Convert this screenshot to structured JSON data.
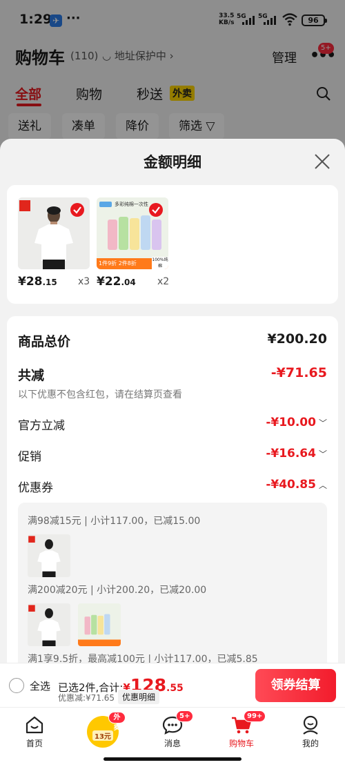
{
  "status_bar": {
    "time": "1:29",
    "dots": "···",
    "net_speed": "33.5",
    "net_unit": "KB/s",
    "sig1": "5G",
    "sig2": "5G",
    "battery": "96"
  },
  "header": {
    "title": "购物车",
    "count": "(110)",
    "address_protect": "地址保护中 ›",
    "manage": "管理",
    "more_badge": "5+"
  },
  "tabs": [
    {
      "label": "全部",
      "active": true
    },
    {
      "label": "购物"
    },
    {
      "label": "秒送"
    }
  ],
  "takeout_tag": "外卖",
  "chips": [
    "送礼",
    "凑单",
    "降价",
    "筛选"
  ],
  "sheet": {
    "title": "金额明细",
    "goods": [
      {
        "price_main": "¥28",
        "price_dec": ".15",
        "qty": "x3",
        "thumb_text": "UNIQLO"
      },
      {
        "price_main": "¥22",
        "price_dec": ".04",
        "qty": "x2",
        "banner_left": "1件9折 2件8折",
        "banner_right": "100%纯棉",
        "pack_title": "多彩纯棉一次性"
      }
    ],
    "rows": {
      "total_label": "商品总价",
      "total_value": "¥200.20",
      "reduce_label": "共减",
      "reduce_value": "-¥71.65",
      "reduce_note": "以下优惠不包含红包，请在结算页查看",
      "official_label": "官方立减",
      "official_value": "-¥10.00",
      "promo_label": "促销",
      "promo_value": "-¥16.64",
      "coupon_label": "优惠券",
      "coupon_value": "-¥40.85"
    },
    "coupon_details": [
      "满98减15元 | 小计117.00，已减15.00",
      "满200减20元 | 小计200.20，已减20.00",
      "满1享9.5折，最高减100元 | 小计117.00，已减5.85"
    ]
  },
  "checkout": {
    "select_all": "全选",
    "summary_prefix": "已选2件,合计:",
    "yen": "¥",
    "total_main": "128",
    "total_dec": ".55",
    "discount": "优惠减:¥71.65",
    "detail_chip": "优惠明细",
    "button": "领券结算"
  },
  "nav": {
    "home": "首页",
    "takeout_badge": "外卖",
    "takeout_coupon": "13元",
    "messages": "消息",
    "messages_badge": "5+",
    "cart": "购物车",
    "cart_badge": "99+",
    "mine": "我的"
  },
  "colors": {
    "accent": "#e8191f",
    "takeout_yellow": "#ffd600"
  }
}
